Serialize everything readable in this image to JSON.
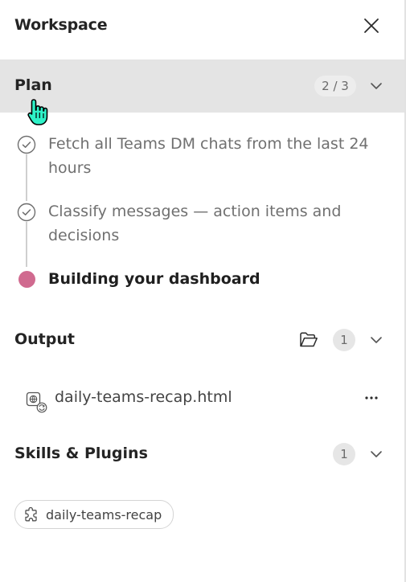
{
  "header": {
    "title": "Workspace",
    "close_icon": "close-icon"
  },
  "plan": {
    "title": "Plan",
    "progress": "2 / 3",
    "steps": [
      {
        "text": "Fetch all Teams DM chats from the last 24 hours",
        "status": "done"
      },
      {
        "text": "Classify messages — action items and decisions",
        "status": "done"
      },
      {
        "text": "Building your dashboard",
        "status": "in-progress"
      }
    ],
    "active_color": "#d06a8f"
  },
  "output": {
    "title": "Output",
    "count": "1",
    "files": [
      {
        "name": "daily-teams-recap.html",
        "icon": "html-file-icon"
      }
    ]
  },
  "skills": {
    "title": "Skills & Plugins",
    "count": "1",
    "items": [
      {
        "label": "daily-teams-recap",
        "icon": "plugin-icon"
      }
    ]
  }
}
